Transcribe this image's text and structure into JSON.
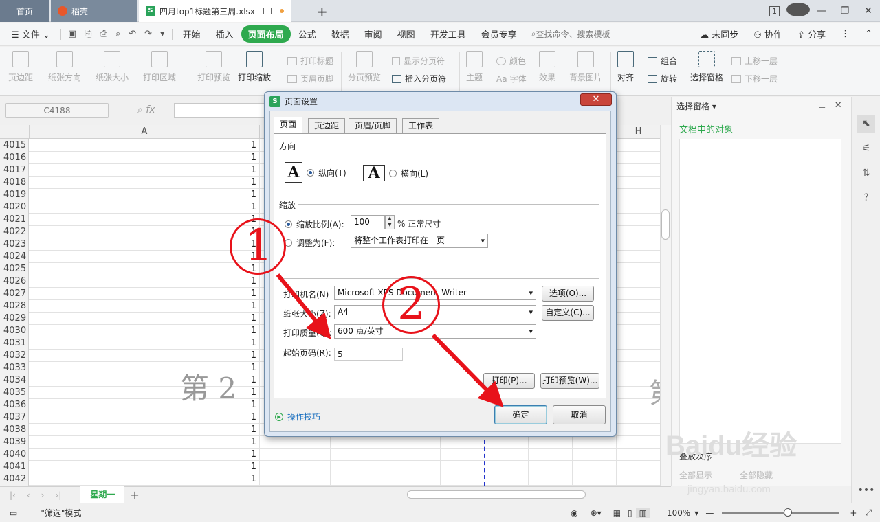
{
  "titlebar": {
    "tab_home": "首页",
    "tab_daoke": "稻壳",
    "tab_file": "四月top1标题第三周.xlsx",
    "new_tab": "+",
    "badge": "1"
  },
  "menubar": {
    "file": "文件",
    "items": [
      "开始",
      "插入",
      "页面布局",
      "公式",
      "数据",
      "审阅",
      "视图",
      "开发工具",
      "会员专享"
    ],
    "search": "查找命令、搜索模板",
    "sync": "未同步",
    "collab": "协作",
    "share": "分享"
  },
  "ribbon": {
    "margin": "页边距",
    "orientation": "纸张方向",
    "size": "纸张大小",
    "print_area": "打印区域",
    "print_preview": "打印预览",
    "print_scale": "打印缩放",
    "print_titles": "打印标题",
    "header_footer": "页眉页脚",
    "page_break_preview": "分页预览",
    "show_page_breaks": "显示分页符",
    "insert_page_break": "插入分页符",
    "theme": "主题",
    "color": "颜色",
    "font": "字体",
    "effect": "效果",
    "background": "背景图片",
    "align": "对齐",
    "group": "组合",
    "rotate": "旋转",
    "selection_pane": "选择窗格",
    "bring_forward": "上移一层",
    "send_backward": "下移一层"
  },
  "formula": {
    "namebox": "C4188",
    "fx": "fx"
  },
  "sheet": {
    "col_a": "A",
    "col_h": "H",
    "rows": [
      {
        "n": "4015",
        "v": "1"
      },
      {
        "n": "4016",
        "v": "1"
      },
      {
        "n": "4017",
        "v": "1"
      },
      {
        "n": "4018",
        "v": "1"
      },
      {
        "n": "4019",
        "v": "1"
      },
      {
        "n": "4020",
        "v": "1"
      },
      {
        "n": "4021",
        "v": "1"
      },
      {
        "n": "4022",
        "v": "1"
      },
      {
        "n": "4023",
        "v": "1"
      },
      {
        "n": "4024",
        "v": "1"
      },
      {
        "n": "4025",
        "v": "1"
      },
      {
        "n": "4026",
        "v": "1"
      },
      {
        "n": "4027",
        "v": "1"
      },
      {
        "n": "4028",
        "v": "1"
      },
      {
        "n": "4029",
        "v": "1"
      },
      {
        "n": "4030",
        "v": "1"
      },
      {
        "n": "4031",
        "v": "1"
      },
      {
        "n": "4032",
        "v": "1"
      },
      {
        "n": "4033",
        "v": "1"
      },
      {
        "n": "4034",
        "v": "1"
      },
      {
        "n": "4035",
        "v": "1"
      },
      {
        "n": "4036",
        "v": "1"
      },
      {
        "n": "4037",
        "v": "1"
      },
      {
        "n": "4038",
        "v": "1"
      },
      {
        "n": "4039",
        "v": "1"
      },
      {
        "n": "4040",
        "v": "1"
      },
      {
        "n": "4041",
        "v": "1"
      },
      {
        "n": "4042",
        "v": "1"
      }
    ],
    "watermark": "第 2",
    "watermark2": "第",
    "sheet_tab": "星期一"
  },
  "status": {
    "filter_mode": "\"筛选\"模式",
    "zoom": "100%"
  },
  "pane": {
    "title": "选择窗格",
    "subtitle": "文档中的对象",
    "order": "叠放次序",
    "show_all": "全部显示",
    "hide_all": "全部隐藏"
  },
  "dialog": {
    "title": "页面设置",
    "tabs": [
      "页面",
      "页边距",
      "页眉/页脚",
      "工作表"
    ],
    "orientation_section": "方向",
    "portrait": "纵向(T)",
    "landscape": "横向(L)",
    "scale_section": "缩放",
    "scale_ratio": "缩放比例(A):",
    "scale_value": "100",
    "scale_suffix": "% 正常尺寸",
    "fit_to": "调整为(F):",
    "fit_option": "将整个工作表打印在一页",
    "printer_name": "打印机名(N)",
    "printer_value": "Microsoft XPS Document Writer",
    "options_btn": "选项(O)...",
    "paper_size": "纸张大小(Z):",
    "paper_value": "A4",
    "custom_btn": "自定义(C)...",
    "print_quality": "打印质量(Q):",
    "quality_value": "600 点/英寸",
    "first_page": "起始页码(R):",
    "first_page_value": "5",
    "print_btn": "打印(P)...",
    "preview_btn": "打印预览(W)...",
    "tips": "操作技巧",
    "ok_btn": "确定",
    "cancel_btn": "取消"
  },
  "annotations": {
    "step1": "1",
    "step2": "2",
    "color": "#e8121a"
  },
  "watermark_site": {
    "logo": "Baidu经验",
    "url": "jingyan.baidu.com"
  }
}
